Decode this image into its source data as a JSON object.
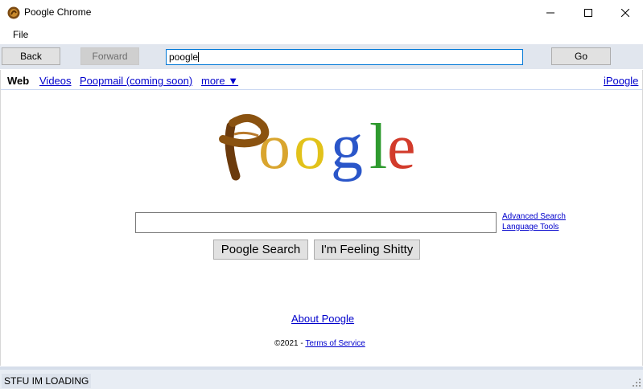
{
  "window": {
    "title": "Poogle Chrome"
  },
  "menu": {
    "file": "File"
  },
  "toolbar": {
    "back": "Back",
    "forward": "Forward",
    "address": "poogle",
    "go": "Go"
  },
  "nav": {
    "web": "Web",
    "videos": "Videos",
    "poopmail": "Poopmail (coming soon)",
    "more": "more ▼",
    "ipoogle": "iPoogle"
  },
  "logo": {
    "letters": [
      "P",
      "o",
      "o",
      "g",
      "l",
      "e"
    ]
  },
  "search": {
    "advanced": "Advanced Search",
    "language": "Language Tools",
    "search_button": "Poogle Search",
    "lucky_button": "I'm Feeling Shitty"
  },
  "footer": {
    "about": "About Poogle",
    "copyright": "©2021 - ",
    "terms": "Terms of Service"
  },
  "status": {
    "text": "STFU IM LOADING"
  },
  "colors": {
    "accent": "#0078d7",
    "link": "#0000cc",
    "toolbar": "#e1e6ee"
  }
}
